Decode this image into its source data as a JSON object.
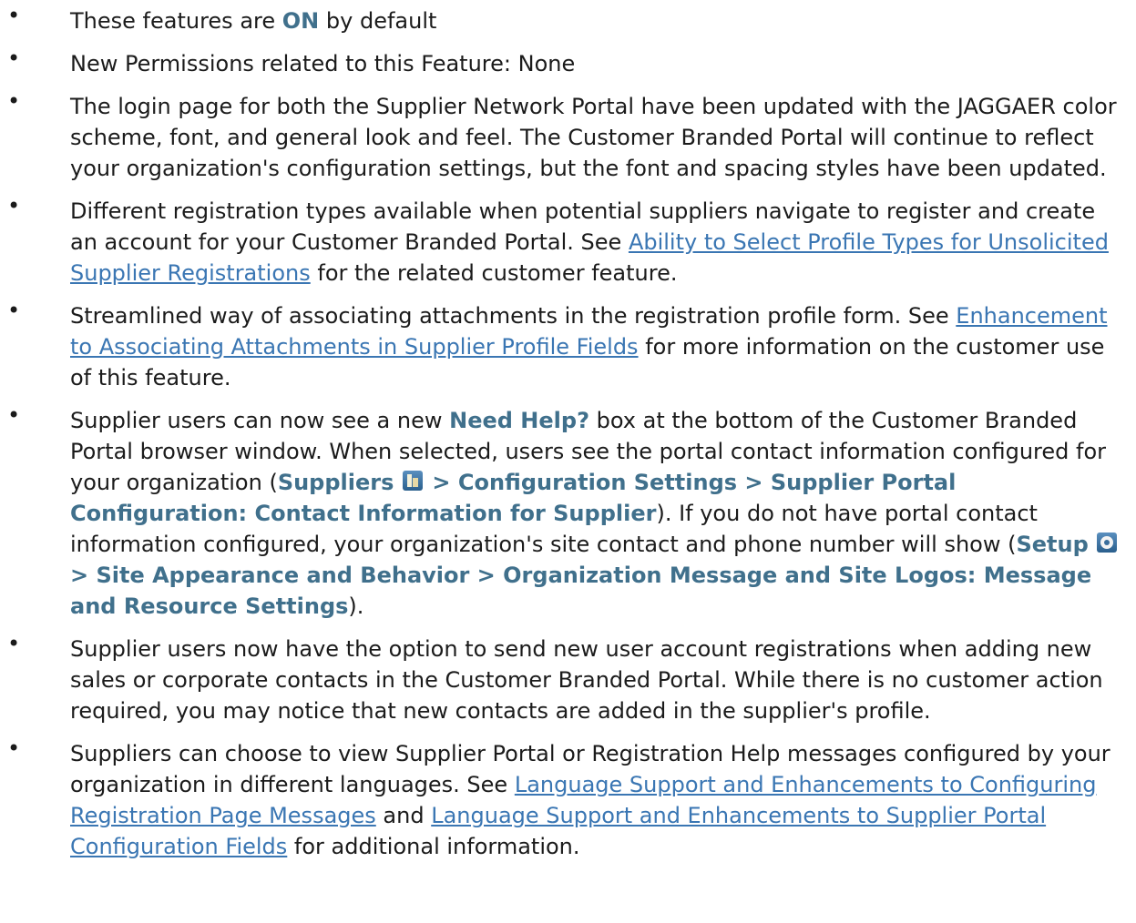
{
  "items": [
    {
      "pre": "These features are ",
      "bold": "ON",
      "post": " by default"
    },
    {
      "text": "New Permissions related to this Feature: None"
    },
    {
      "text": "The login page for both the Supplier Network Portal have been updated with the JAGGAER color scheme, font, and general look and feel. The Customer Branded Portal will continue to reflect your organization's configuration settings, but the font and spacing styles have been updated."
    },
    {
      "pre": "Different registration types available when potential suppliers navigate to register and create an account for your Customer Branded Portal. See ",
      "link": "Ability to Select Profile Types for Unsolicited Supplier Registrations",
      "post": " for the related customer feature."
    },
    {
      "pre": "Streamlined way of associating attachments in the registration profile form. See ",
      "link": "Enhancement to Associating Attachments in Supplier Profile Fields",
      "post": " for more information on the customer use of this feature."
    },
    {
      "pre": "Supplier users can now see a new ",
      "bold1": "Need Help?",
      "mid1": " box at the bottom of the Customer Branded Portal browser window. When selected, users see the portal contact information configured for your organization (",
      "path1_start": "Suppliers",
      "path1_end": " > Configuration Settings > Supplier Portal Configuration: Contact Information for Supplier",
      "mid2": "). If you do not have portal contact information configured, your organization's site contact and phone number will show (",
      "path2_start": "Setup",
      "path2_end": " > Site Appearance and Behavior > Organization Message and Site Logos: Message and Resource Settings",
      "post": ")."
    },
    {
      "text": "Supplier users now have the option to send new user account registrations when adding new sales or corporate contacts in the Customer Branded Portal. While there is no customer action required, you may notice that new contacts are added in the supplier's profile."
    },
    {
      "pre": "Suppliers can choose to view Supplier Portal or Registration Help messages configured by your organization in different languages. See ",
      "link1": "Language Support and Enhancements to Configuring Registration Page Messages",
      "mid": " and ",
      "link2": "Language Support and Enhancements to Supplier Portal Configuration Fields",
      "post": " for additional information."
    }
  ],
  "icons": {
    "suppliers": "suppliers-icon",
    "setup": "setup-icon"
  },
  "colors": {
    "bold_path": "#40708c",
    "link": "#3a76b3",
    "text": "#1b1b1b"
  }
}
